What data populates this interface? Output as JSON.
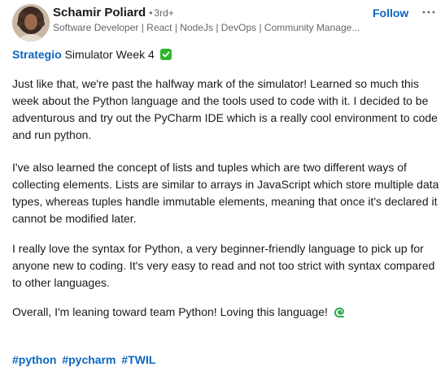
{
  "author": {
    "name": "Schamir Poliard",
    "separator": "•",
    "degree": "3rd+",
    "headline": "Software Developer | React | NodeJs | DevOps | Community Manage..."
  },
  "actions": {
    "follow_label": "Follow",
    "more_icon": "ellipsis-horizontal-icon"
  },
  "post": {
    "mention": "Strategio",
    "title_rest": " Simulator Week 4",
    "title_emoji": "check-mark-button-icon",
    "paragraph_1": "Just like that, we're past the halfway mark of the simulator! Learned so much this week about the Python language and the tools used to code with it. I decided to be adventurous and try out the PyCharm IDE which is a really cool environment to code and run python.",
    "paragraph_2": "I've also learned the concept of lists and tuples which are two different ways of collecting elements. Lists are similar to arrays in JavaScript which store multiple data types, whereas tuples handle immutable elements, meaning that once it's declared it cannot be modified later.",
    "paragraph_3": "I really love the syntax for Python, a very beginner-friendly language to pick up for anyone new to coding. It's very easy to read and not too strict with syntax compared to other languages.",
    "paragraph_4": "Overall, I'm leaning toward team Python! Loving this language! ",
    "closing_emoji": "green-swirl-icon",
    "hashtags": [
      "#python",
      "#pycharm",
      "#TWIL"
    ]
  },
  "colors": {
    "link_blue": "#0a66c2",
    "text_primary": "#191919",
    "text_secondary": "#666666",
    "check_green": "#2eb52e"
  }
}
